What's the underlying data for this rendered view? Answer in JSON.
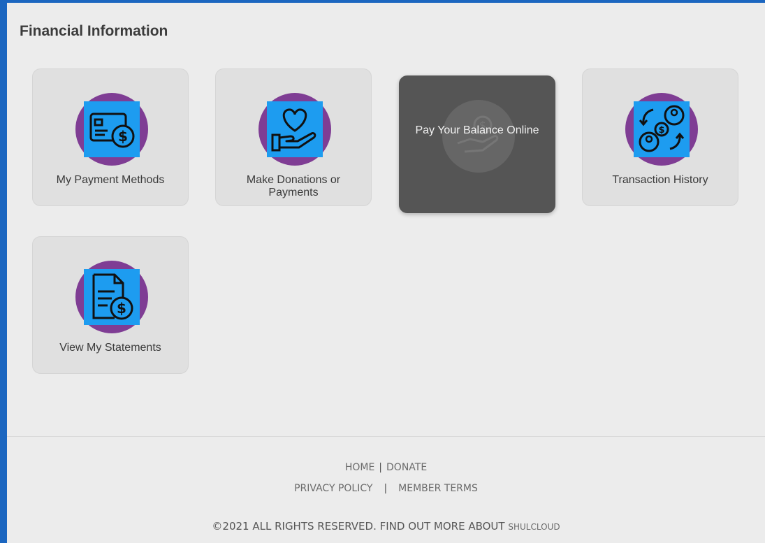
{
  "page": {
    "title": "Financial Information"
  },
  "tiles": [
    {
      "label": "My Payment Methods",
      "icon": "wallet-dollar-icon"
    },
    {
      "label": "Make Donations or Payments",
      "icon": "heart-hand-icon"
    },
    {
      "label": "Pay Your Balance Online",
      "icon": "hand-coin-icon"
    },
    {
      "label": "Transaction History",
      "icon": "people-exchange-icon"
    },
    {
      "label": "View My Statements",
      "icon": "document-dollar-icon"
    }
  ],
  "footer": {
    "home": "HOME",
    "divider1": "|",
    "donate": "DONATE",
    "privacy": "PRIVACY POLICY",
    "divider2": "|",
    "terms": "MEMBER TERMS",
    "copyright": "©2021 ALL RIGHTS RESERVED. FIND OUT MORE ABOUT",
    "brand": "SHULCLOUD"
  },
  "colors": {
    "accent_blue": "#1d9cf0",
    "circle_purple": "#7f3d94",
    "frame_blue": "#1b66c0",
    "active_tile": "#555555"
  }
}
